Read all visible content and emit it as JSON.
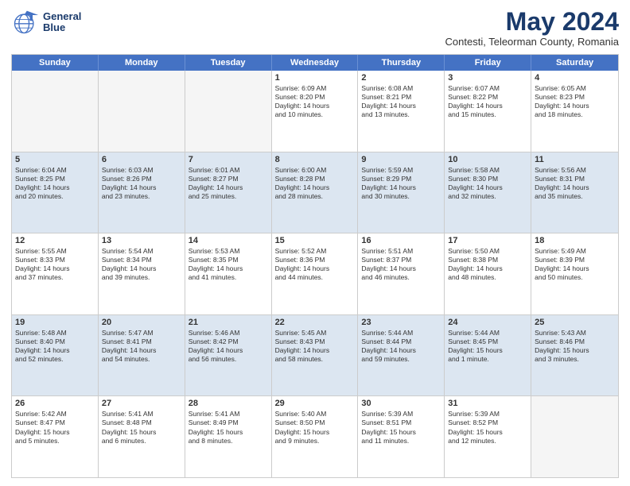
{
  "header": {
    "logo_line1": "General",
    "logo_line2": "Blue",
    "title": "May 2024",
    "subtitle": "Contesti, Teleorman County, Romania"
  },
  "days_of_week": [
    "Sunday",
    "Monday",
    "Tuesday",
    "Wednesday",
    "Thursday",
    "Friday",
    "Saturday"
  ],
  "rows": [
    [
      {
        "day": "",
        "text": "",
        "empty": true
      },
      {
        "day": "",
        "text": "",
        "empty": true
      },
      {
        "day": "",
        "text": "",
        "empty": true
      },
      {
        "day": "1",
        "text": "Sunrise: 6:09 AM\nSunset: 8:20 PM\nDaylight: 14 hours\nand 10 minutes."
      },
      {
        "day": "2",
        "text": "Sunrise: 6:08 AM\nSunset: 8:21 PM\nDaylight: 14 hours\nand 13 minutes."
      },
      {
        "day": "3",
        "text": "Sunrise: 6:07 AM\nSunset: 8:22 PM\nDaylight: 14 hours\nand 15 minutes."
      },
      {
        "day": "4",
        "text": "Sunrise: 6:05 AM\nSunset: 8:23 PM\nDaylight: 14 hours\nand 18 minutes."
      }
    ],
    [
      {
        "day": "5",
        "text": "Sunrise: 6:04 AM\nSunset: 8:25 PM\nDaylight: 14 hours\nand 20 minutes."
      },
      {
        "day": "6",
        "text": "Sunrise: 6:03 AM\nSunset: 8:26 PM\nDaylight: 14 hours\nand 23 minutes."
      },
      {
        "day": "7",
        "text": "Sunrise: 6:01 AM\nSunset: 8:27 PM\nDaylight: 14 hours\nand 25 minutes."
      },
      {
        "day": "8",
        "text": "Sunrise: 6:00 AM\nSunset: 8:28 PM\nDaylight: 14 hours\nand 28 minutes."
      },
      {
        "day": "9",
        "text": "Sunrise: 5:59 AM\nSunset: 8:29 PM\nDaylight: 14 hours\nand 30 minutes."
      },
      {
        "day": "10",
        "text": "Sunrise: 5:58 AM\nSunset: 8:30 PM\nDaylight: 14 hours\nand 32 minutes."
      },
      {
        "day": "11",
        "text": "Sunrise: 5:56 AM\nSunset: 8:31 PM\nDaylight: 14 hours\nand 35 minutes."
      }
    ],
    [
      {
        "day": "12",
        "text": "Sunrise: 5:55 AM\nSunset: 8:33 PM\nDaylight: 14 hours\nand 37 minutes."
      },
      {
        "day": "13",
        "text": "Sunrise: 5:54 AM\nSunset: 8:34 PM\nDaylight: 14 hours\nand 39 minutes."
      },
      {
        "day": "14",
        "text": "Sunrise: 5:53 AM\nSunset: 8:35 PM\nDaylight: 14 hours\nand 41 minutes."
      },
      {
        "day": "15",
        "text": "Sunrise: 5:52 AM\nSunset: 8:36 PM\nDaylight: 14 hours\nand 44 minutes."
      },
      {
        "day": "16",
        "text": "Sunrise: 5:51 AM\nSunset: 8:37 PM\nDaylight: 14 hours\nand 46 minutes."
      },
      {
        "day": "17",
        "text": "Sunrise: 5:50 AM\nSunset: 8:38 PM\nDaylight: 14 hours\nand 48 minutes."
      },
      {
        "day": "18",
        "text": "Sunrise: 5:49 AM\nSunset: 8:39 PM\nDaylight: 14 hours\nand 50 minutes."
      }
    ],
    [
      {
        "day": "19",
        "text": "Sunrise: 5:48 AM\nSunset: 8:40 PM\nDaylight: 14 hours\nand 52 minutes."
      },
      {
        "day": "20",
        "text": "Sunrise: 5:47 AM\nSunset: 8:41 PM\nDaylight: 14 hours\nand 54 minutes."
      },
      {
        "day": "21",
        "text": "Sunrise: 5:46 AM\nSunset: 8:42 PM\nDaylight: 14 hours\nand 56 minutes."
      },
      {
        "day": "22",
        "text": "Sunrise: 5:45 AM\nSunset: 8:43 PM\nDaylight: 14 hours\nand 58 minutes."
      },
      {
        "day": "23",
        "text": "Sunrise: 5:44 AM\nSunset: 8:44 PM\nDaylight: 14 hours\nand 59 minutes."
      },
      {
        "day": "24",
        "text": "Sunrise: 5:44 AM\nSunset: 8:45 PM\nDaylight: 15 hours\nand 1 minute."
      },
      {
        "day": "25",
        "text": "Sunrise: 5:43 AM\nSunset: 8:46 PM\nDaylight: 15 hours\nand 3 minutes."
      }
    ],
    [
      {
        "day": "26",
        "text": "Sunrise: 5:42 AM\nSunset: 8:47 PM\nDaylight: 15 hours\nand 5 minutes."
      },
      {
        "day": "27",
        "text": "Sunrise: 5:41 AM\nSunset: 8:48 PM\nDaylight: 15 hours\nand 6 minutes."
      },
      {
        "day": "28",
        "text": "Sunrise: 5:41 AM\nSunset: 8:49 PM\nDaylight: 15 hours\nand 8 minutes."
      },
      {
        "day": "29",
        "text": "Sunrise: 5:40 AM\nSunset: 8:50 PM\nDaylight: 15 hours\nand 9 minutes."
      },
      {
        "day": "30",
        "text": "Sunrise: 5:39 AM\nSunset: 8:51 PM\nDaylight: 15 hours\nand 11 minutes."
      },
      {
        "day": "31",
        "text": "Sunrise: 5:39 AM\nSunset: 8:52 PM\nDaylight: 15 hours\nand 12 minutes."
      },
      {
        "day": "",
        "text": "",
        "empty": true
      }
    ]
  ]
}
